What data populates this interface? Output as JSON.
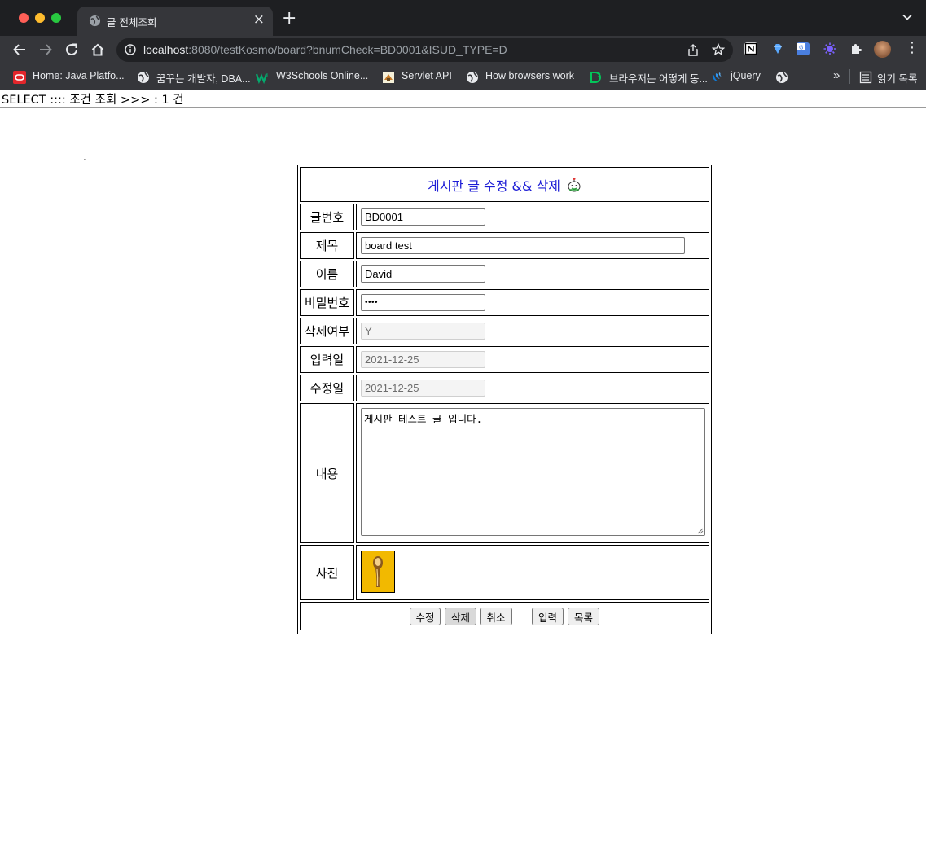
{
  "browser": {
    "tab_title": "글 전체조회",
    "url_host": "localhost",
    "url_rest": ":8080/testKosmo/board?bnumCheck=BD0001&ISUD_TYPE=D",
    "bookmarks": [
      {
        "label": "Home: Java Platfo..."
      },
      {
        "label": "꿈꾸는 개발자, DBA..."
      },
      {
        "label": "W3Schools Online..."
      },
      {
        "label": "Servlet API"
      },
      {
        "label": "How browsers work"
      },
      {
        "label": "브라우저는 어떻게 동..."
      },
      {
        "label": "jQuery"
      }
    ],
    "overflow_label": "»",
    "reading_list_label": "읽기 목록"
  },
  "page": {
    "status_line": "SELECT :::: 조건 조회 >>> : 1 건",
    "dot": ".",
    "board": {
      "title": "게시판 글 수정 && 삭제",
      "labels": {
        "bnum": "글번호",
        "subject": "제목",
        "name": "이름",
        "password": "비밀번호",
        "deleted": "삭제여부",
        "created": "입력일",
        "updated": "수정일",
        "content": "내용",
        "photo": "사진"
      },
      "values": {
        "bnum": "BD0001",
        "subject": "board test",
        "name": "David",
        "password": "••••",
        "deleted": "Y",
        "created": "2021-12-25",
        "updated": "2021-12-25",
        "content": "게시판 테스트 글 입니다."
      },
      "buttons": {
        "update": "수정",
        "delete": "삭제",
        "cancel": "취소",
        "insert": "입력",
        "list": "목록"
      }
    }
  }
}
